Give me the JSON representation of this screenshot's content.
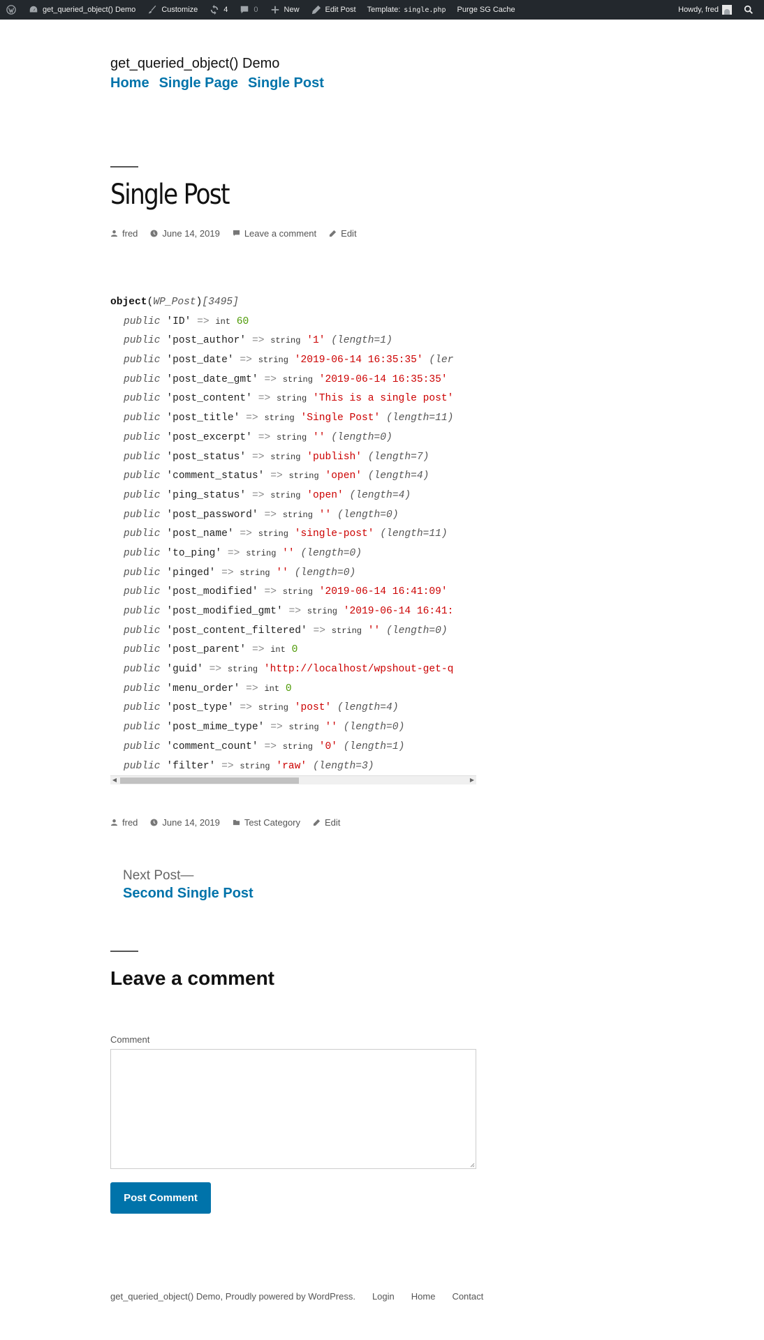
{
  "admin_bar": {
    "site_name": "get_queried_object() Demo",
    "customize": "Customize",
    "updates_count": "4",
    "comments_count": "0",
    "new": "New",
    "edit_post": "Edit Post",
    "template_label": "Template:",
    "template_file": "single.php",
    "purge": "Purge SG Cache",
    "howdy": "Howdy, fred"
  },
  "site": {
    "title": "get_queried_object() Demo",
    "nav": [
      "Home",
      "Single Page",
      "Single Post"
    ]
  },
  "post": {
    "title": "Single Post",
    "author": "fred",
    "date": "June 14, 2019",
    "comment_link": "Leave a comment",
    "edit": "Edit",
    "category": "Test Category"
  },
  "dump": {
    "header_keyword": "object",
    "class_name": "WP_Post",
    "object_id": "[3495]",
    "lines": [
      {
        "visibility": "public",
        "key": "'ID'",
        "arrow": "=>",
        "type": "int",
        "value": "60",
        "length": ""
      },
      {
        "visibility": "public",
        "key": "'post_author'",
        "arrow": "=>",
        "type": "string",
        "value": "'1'",
        "length": "(length=1)"
      },
      {
        "visibility": "public",
        "key": "'post_date'",
        "arrow": "=>",
        "type": "string",
        "value": "'2019-06-14 16:35:35'",
        "length": "(ler"
      },
      {
        "visibility": "public",
        "key": "'post_date_gmt'",
        "arrow": "=>",
        "type": "string",
        "value": "'2019-06-14 16:35:35'",
        "length": ""
      },
      {
        "visibility": "public",
        "key": "'post_content'",
        "arrow": "=>",
        "type": "string",
        "value": "'This is a single post'",
        "length": ""
      },
      {
        "visibility": "public",
        "key": "'post_title'",
        "arrow": "=>",
        "type": "string",
        "value": "'Single Post'",
        "length": "(length=11)"
      },
      {
        "visibility": "public",
        "key": "'post_excerpt'",
        "arrow": "=>",
        "type": "string",
        "value": "''",
        "length": "(length=0)"
      },
      {
        "visibility": "public",
        "key": "'post_status'",
        "arrow": "=>",
        "type": "string",
        "value": "'publish'",
        "length": "(length=7)"
      },
      {
        "visibility": "public",
        "key": "'comment_status'",
        "arrow": "=>",
        "type": "string",
        "value": "'open'",
        "length": "(length=4)"
      },
      {
        "visibility": "public",
        "key": "'ping_status'",
        "arrow": "=>",
        "type": "string",
        "value": "'open'",
        "length": "(length=4)"
      },
      {
        "visibility": "public",
        "key": "'post_password'",
        "arrow": "=>",
        "type": "string",
        "value": "''",
        "length": "(length=0)"
      },
      {
        "visibility": "public",
        "key": "'post_name'",
        "arrow": "=>",
        "type": "string",
        "value": "'single-post'",
        "length": "(length=11)"
      },
      {
        "visibility": "public",
        "key": "'to_ping'",
        "arrow": "=>",
        "type": "string",
        "value": "''",
        "length": "(length=0)"
      },
      {
        "visibility": "public",
        "key": "'pinged'",
        "arrow": "=>",
        "type": "string",
        "value": "''",
        "length": "(length=0)"
      },
      {
        "visibility": "public",
        "key": "'post_modified'",
        "arrow": "=>",
        "type": "string",
        "value": "'2019-06-14 16:41:09'",
        "length": ""
      },
      {
        "visibility": "public",
        "key": "'post_modified_gmt'",
        "arrow": "=>",
        "type": "string",
        "value": "'2019-06-14 16:41:",
        "length": ""
      },
      {
        "visibility": "public",
        "key": "'post_content_filtered'",
        "arrow": "=>",
        "type": "string",
        "value": "''",
        "length": "(length=0)"
      },
      {
        "visibility": "public",
        "key": "'post_parent'",
        "arrow": "=>",
        "type": "int",
        "value": "0",
        "length": ""
      },
      {
        "visibility": "public",
        "key": "'guid'",
        "arrow": "=>",
        "type": "string",
        "value": "'http://localhost/wpshout-get-q",
        "length": ""
      },
      {
        "visibility": "public",
        "key": "'menu_order'",
        "arrow": "=>",
        "type": "int",
        "value": "0",
        "length": ""
      },
      {
        "visibility": "public",
        "key": "'post_type'",
        "arrow": "=>",
        "type": "string",
        "value": "'post'",
        "length": "(length=4)"
      },
      {
        "visibility": "public",
        "key": "'post_mime_type'",
        "arrow": "=>",
        "type": "string",
        "value": "''",
        "length": "(length=0)"
      },
      {
        "visibility": "public",
        "key": "'comment_count'",
        "arrow": "=>",
        "type": "string",
        "value": "'0'",
        "length": "(length=1)"
      },
      {
        "visibility": "public",
        "key": "'filter'",
        "arrow": "=>",
        "type": "string",
        "value": "'raw'",
        "length": "(length=3)"
      }
    ]
  },
  "post_nav": {
    "label": "Next Post—",
    "title": "Second Single Post"
  },
  "comments": {
    "heading": "Leave a comment",
    "field_label": "Comment",
    "field_value": "",
    "submit": "Post Comment"
  },
  "footer": {
    "credit": "get_queried_object() Demo, Proudly powered by WordPress.",
    "links": [
      "Login",
      "Home",
      "Contact"
    ]
  },
  "colors": {
    "admin_bar_bg": "#23282d",
    "link": "#0073aa",
    "string_value": "#cc0000",
    "int_value": "#4e9a06"
  }
}
